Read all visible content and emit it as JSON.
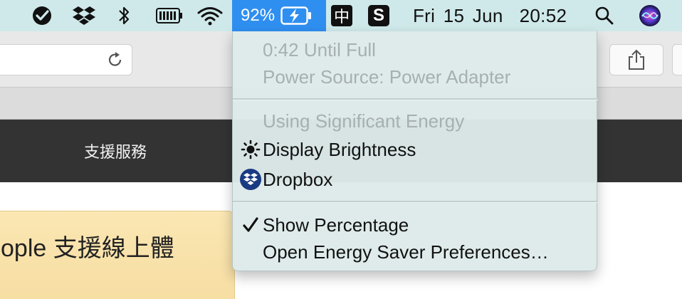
{
  "menubar": {
    "status_icons": [
      "moon-check-icon",
      "dropbox-icon",
      "bluetooth-icon",
      "battery-meter-icon",
      "wifi-icon",
      "input-method-icon",
      "app-s-icon",
      "search-icon",
      "siri-icon"
    ],
    "battery_percent": "92%",
    "input_method_label": "中",
    "app_s_label": "S",
    "clock": "Fri 15 Jun  20:52"
  },
  "toolbar": {
    "reload_icon": "reload-icon",
    "share_icon": "share-icon"
  },
  "page": {
    "nav_support": "支援服務",
    "banner_text": "ople 支援線上體"
  },
  "battery_menu": {
    "time_until_full": "0:42 Until Full",
    "power_source": "Power Source: Power Adapter",
    "significant_energy_heading": "Using Significant Energy",
    "apps": [
      {
        "label": "Display Brightness",
        "icon": "brightness-icon"
      },
      {
        "label": "Dropbox",
        "icon": "dropbox-icon"
      }
    ],
    "show_percentage": "Show Percentage",
    "show_percentage_checked": true,
    "open_prefs": "Open Energy Saver Preferences…"
  },
  "colors": {
    "menubar_bg": "#cfe9ea",
    "menubar_highlight": "#2f8ff0",
    "nav_bg": "#333333",
    "banner_bg": "#fbe7b3"
  }
}
